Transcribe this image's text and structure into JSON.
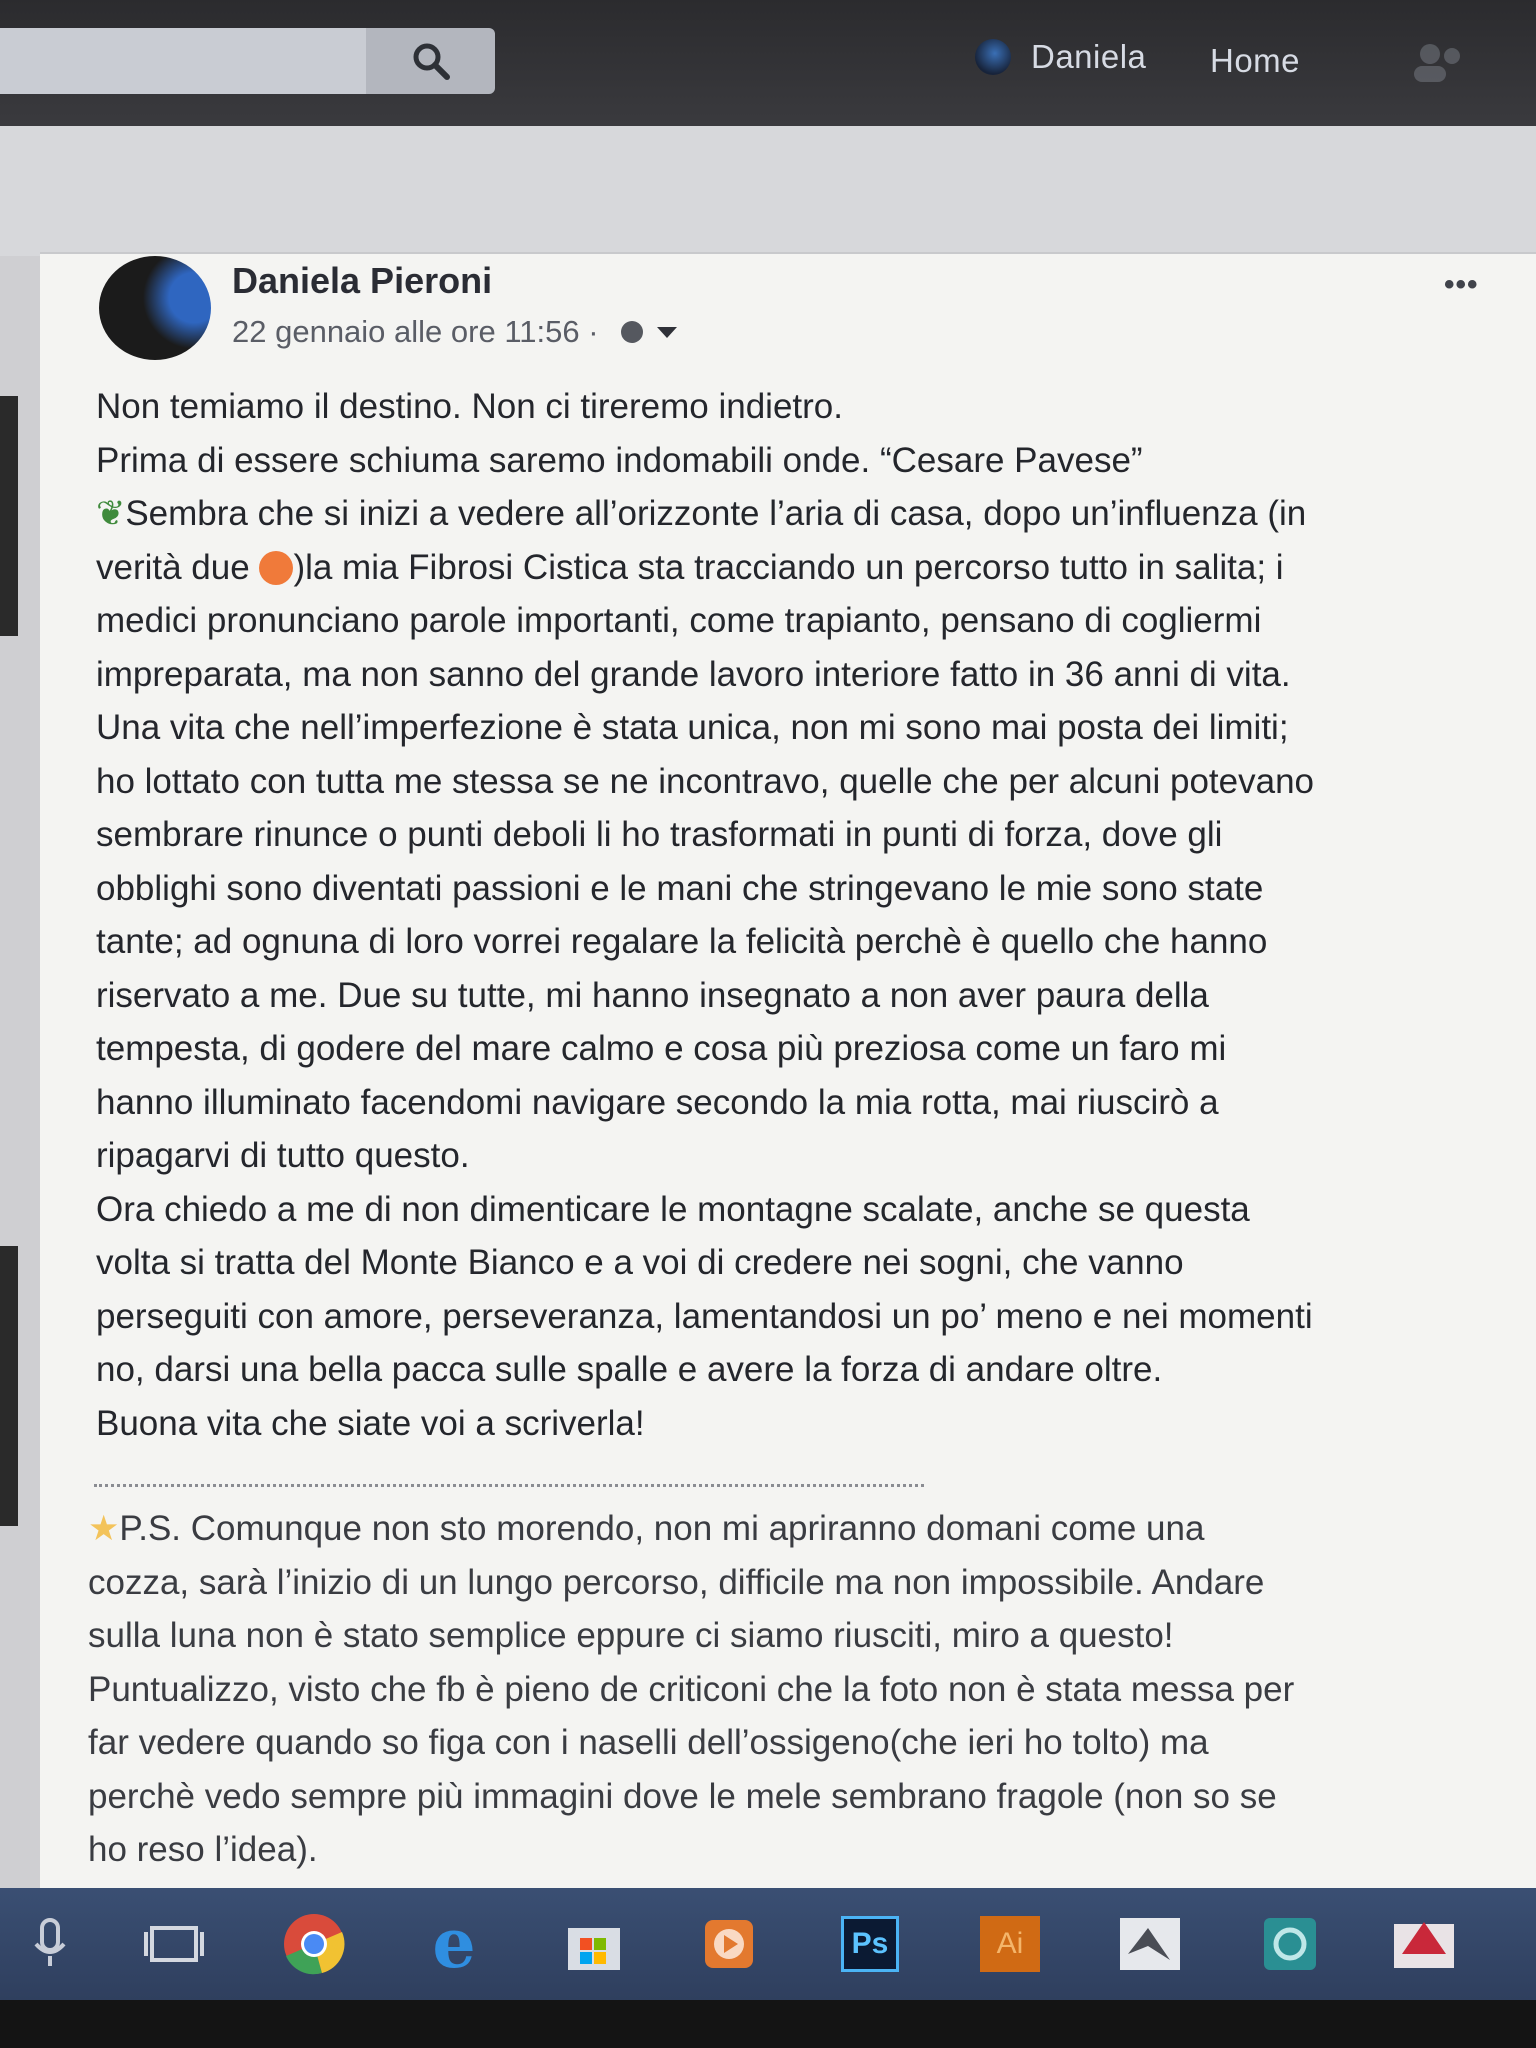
{
  "nav": {
    "search_placeholder": "",
    "user_name": "Daniela",
    "home_label": "Home"
  },
  "post": {
    "author": "Daniela Pieroni",
    "timestamp": "22 gennaio alle ore 11:56 ·",
    "more_label": "•••",
    "lines": [
      "Non temiamo il destino. Non ci tireremo indietro.",
      "Prima di essere schiuma saremo indomabili onde. “Cesare Pavese”",
      "Sembra che si inizi a vedere all’orizzonte l’aria di casa, dopo un’influenza (in",
      "verità due ",
      ")la mia Fibrosi Cistica sta tracciando un percorso tutto in salita; i",
      "medici pronunciano parole importanti, come trapianto, pensano di cogliermi",
      "impreparata, ma non sanno del grande lavoro interiore fatto in 36 anni di vita.",
      "Una vita che nell’imperfezione è stata unica, non mi sono mai posta dei limiti;",
      "ho lottato con tutta me stessa se ne incontravo, quelle che per alcuni potevano",
      "sembrare rinunce o punti deboli li ho trasformati in punti di forza, dove gli",
      "obblighi sono diventati passioni e le mani che stringevano le mie sono state",
      "tante; ad ognuna di loro vorrei regalare la felicità perchè è quello che hanno",
      "riservato a me. Due su tutte, mi hanno insegnato a non aver paura della",
      "tempesta, di godere del mare calmo e cosa più preziosa come un faro mi",
      "hanno illuminato facendomi navigare secondo la mia rotta, mai riuscirò a",
      "ripagarvi di tutto questo.",
      "Ora chiedo a me di non dimenticare le montagne scalate, anche se questa",
      "volta si tratta del Monte Bianco e a voi di credere nei sogni, che vanno",
      "perseguiti con amore, perseveranza, lamentandosi un po’ meno e nei momenti",
      "no, darsi una bella pacca sulle spalle e avere la forza di andare oltre.",
      "Buona vita che siate voi a scriverla!"
    ],
    "ps_lines": [
      "P.S. Comunque non sto morendo, non mi apriranno domani come una",
      "cozza, sarà l’inizio di un lungo percorso, difficile ma non impossibile. Andare",
      "sulla luna non è stato semplice eppure ci siamo riusciti, miro a questo!",
      "Puntualizzo, visto che fb è pieno de criticoni che la foto non è stata messa per",
      "far vedere quando so figa con i naselli dell’ossigeno(che ieri ho tolto) ma",
      "perchè vedo sempre più immagini dove le mele sembrano fragole (non so se",
      "ho reso l’idea)."
    ]
  },
  "taskbar": {
    "photoshop_label": "Ps",
    "illustrator_label": "Ai",
    "edge_label": "e"
  },
  "colors": {
    "nav_bg": "#2b2b2e",
    "card_bg": "#f4f4f2",
    "taskbar_bg": "#3a4f73"
  }
}
